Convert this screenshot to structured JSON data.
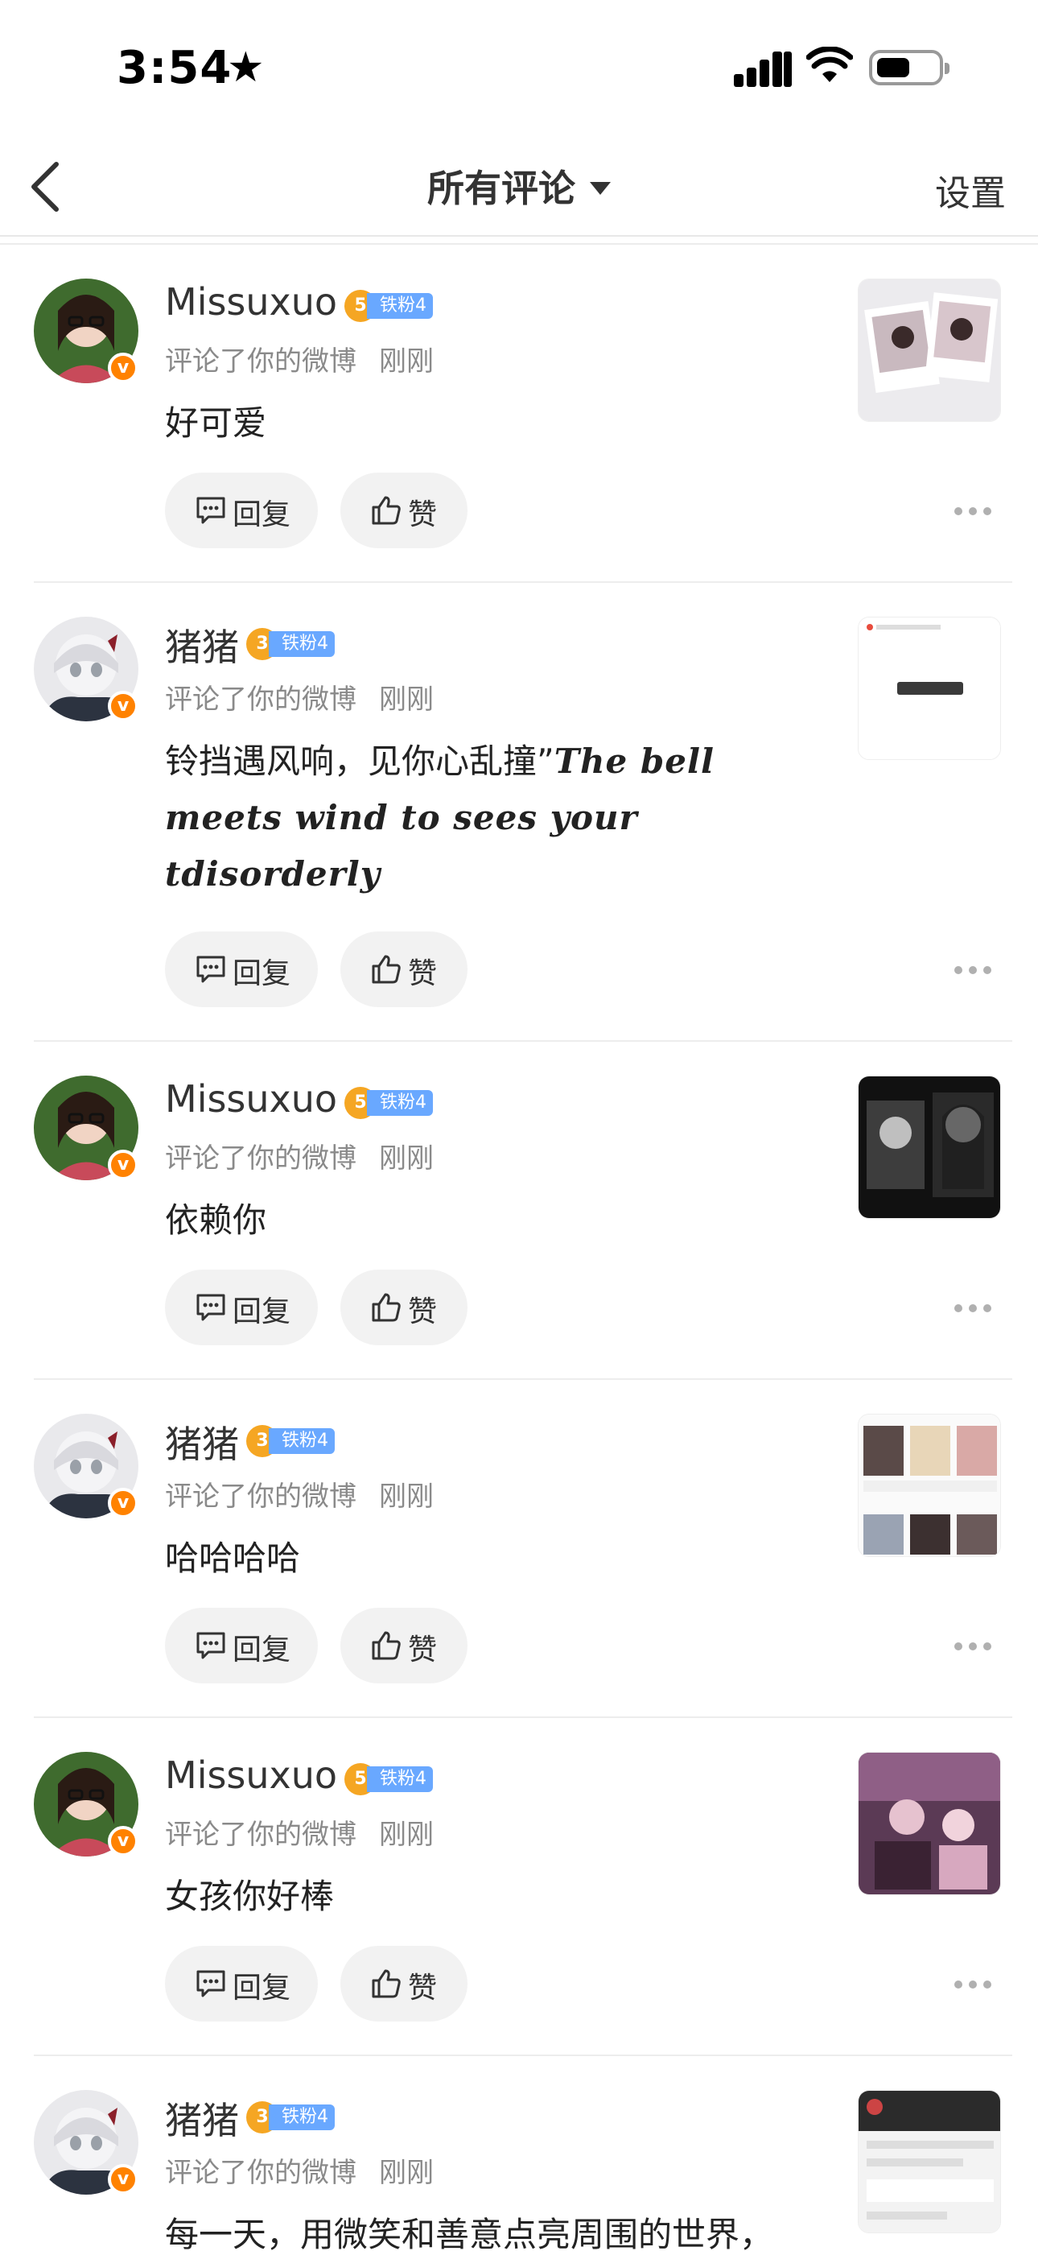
{
  "status": {
    "time": "3:54"
  },
  "header": {
    "title": "所有评论",
    "settings": "设置"
  },
  "items": [
    {
      "name": "Missuxuo",
      "fan_level": "5",
      "fan_label": "铁粉4",
      "action": "评论了你的微博",
      "time": "刚刚",
      "comment": "好可爱",
      "comment_fancy": "",
      "reply": "回复",
      "like": "赞"
    },
    {
      "name": "猪猪",
      "fan_level": "3",
      "fan_label": "铁粉4",
      "action": "评论了你的微博",
      "time": "刚刚",
      "comment": "铃挡遇风响，见你心乱撞”",
      "comment_fancy": "The bell meets wind to sees your tdisorderly",
      "reply": "回复",
      "like": "赞"
    },
    {
      "name": "Missuxuo",
      "fan_level": "5",
      "fan_label": "铁粉4",
      "action": "评论了你的微博",
      "time": "刚刚",
      "comment": "依赖你",
      "comment_fancy": "",
      "reply": "回复",
      "like": "赞"
    },
    {
      "name": "猪猪",
      "fan_level": "3",
      "fan_label": "铁粉4",
      "action": "评论了你的微博",
      "time": "刚刚",
      "comment": "哈哈哈哈",
      "comment_fancy": "",
      "reply": "回复",
      "like": "赞"
    },
    {
      "name": "Missuxuo",
      "fan_level": "5",
      "fan_label": "铁粉4",
      "action": "评论了你的微博",
      "time": "刚刚",
      "comment": "女孩你好棒",
      "comment_fancy": "",
      "reply": "回复",
      "like": "赞"
    },
    {
      "name": "猪猪",
      "fan_level": "3",
      "fan_label": "铁粉4",
      "action": "评论了你的微博",
      "time": "刚刚",
      "comment": "每一天，用微笑和善意点亮周围的世界，",
      "comment_fancy": "",
      "reply": "回复",
      "like": "赞"
    }
  ]
}
